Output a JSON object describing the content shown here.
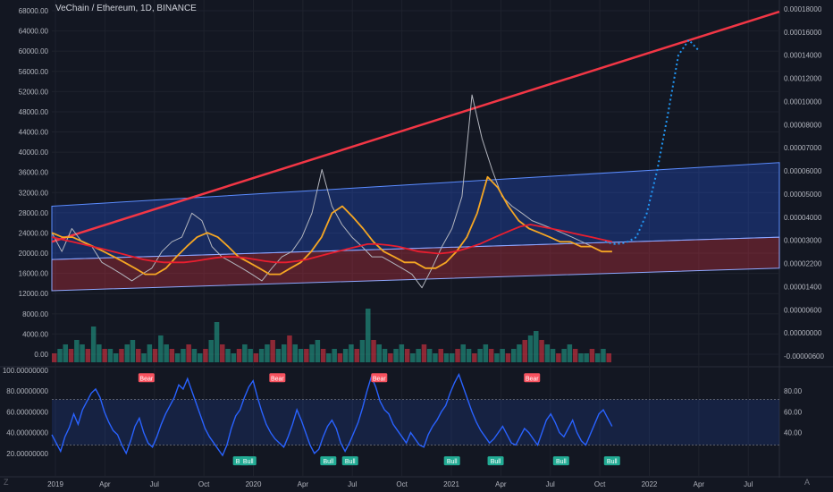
{
  "chart_title": "VeChain / Ethereum, 1D, BINANCE",
  "auto_label": "A",
  "colors": {
    "background": "#131722",
    "grid": "#1e222d",
    "price_line": "#b2b5be",
    "trend_line": "#f23645",
    "channel_blue": "#2962ff",
    "channel_red": "#f23645",
    "ma_yellow": "#f5a623",
    "ma_red": "#e91e2f",
    "projection": "#2196f3",
    "rsi_line": "#2962ff",
    "bear_label": "#f7525f",
    "bull_label": "#22ab94"
  },
  "chart_data": [
    {
      "type": "line",
      "panel": "price",
      "scale": "log",
      "x_ticks": [
        "2019",
        "Apr",
        "Jul",
        "Oct",
        "2020",
        "Apr",
        "Jul",
        "Oct",
        "2021",
        "Apr",
        "Jul",
        "Oct",
        "2022",
        "Apr",
        "Jul"
      ],
      "x": [
        0,
        1,
        2,
        3,
        4,
        5,
        6,
        7,
        8,
        9,
        10,
        11,
        12,
        13,
        14
      ],
      "left_y_ticks": [
        "68000.00",
        "64000.00",
        "60000.00",
        "56000.00",
        "52000.00",
        "48000.00",
        "44000.00",
        "40000.00",
        "36000.00",
        "32000.00",
        "28000.00",
        "24000.00",
        "20000.00",
        "16000.00",
        "12000.00",
        "8000.00",
        "4000.00",
        "0.00"
      ],
      "right_y_ticks": [
        "0.00018000",
        "0.00016000",
        "0.00014000",
        "0.00012000",
        "0.00010000",
        "0.00008000",
        "0.00007000",
        "0.00006000",
        "0.00005000",
        "0.00004000",
        "0.00003000",
        "0.00002200",
        "0.00001400",
        "0.00000600",
        "0.00000000",
        "-0.00000600"
      ],
      "series": [
        {
          "key": "price",
          "values": [
            25,
            21,
            26,
            23,
            22,
            19,
            18,
            17,
            16,
            17,
            18,
            21,
            23,
            24,
            30,
            28,
            22,
            20,
            19,
            18,
            17,
            16,
            18,
            20,
            21,
            24,
            30,
            45,
            32,
            27,
            24,
            22,
            20,
            20,
            19,
            18,
            17,
            15,
            18,
            22,
            26,
            35,
            90,
            60,
            45,
            35,
            32,
            30,
            28,
            27,
            26,
            25,
            24,
            23,
            22,
            21,
            21
          ]
        },
        {
          "key": "ma_yellow",
          "values": [
            25,
            24,
            24,
            23,
            22,
            21,
            20,
            19,
            18,
            17,
            17,
            18,
            20,
            22,
            24,
            25,
            24,
            22,
            20,
            19,
            18,
            17,
            17,
            18,
            19,
            21,
            24,
            30,
            32,
            29,
            26,
            23,
            21,
            20,
            19,
            19,
            18,
            18,
            19,
            21,
            24,
            30,
            42,
            38,
            32,
            28,
            26,
            25,
            24,
            23,
            23,
            22,
            22,
            21,
            21
          ]
        },
        {
          "key": "ma_red",
          "values": [
            24,
            23.5,
            23,
            22.5,
            22,
            21.5,
            21,
            20.5,
            20,
            19.5,
            19.2,
            19,
            19,
            19,
            19.2,
            19.5,
            19.8,
            20,
            20,
            19.8,
            19.5,
            19.2,
            19,
            19,
            19.2,
            19.5,
            20,
            20.5,
            21,
            21.5,
            22,
            22.5,
            22.5,
            22.3,
            22,
            21.5,
            21,
            20.8,
            20.6,
            20.8,
            21.2,
            21.8,
            22.5,
            23.5,
            24.5,
            25.5,
            26.5,
            27,
            26.5,
            26,
            25.5,
            25,
            24.5,
            24,
            23.5,
            23
          ]
        },
        {
          "key": "projection",
          "values": [
            23,
            22.5,
            22.8,
            24,
            30,
            45,
            75,
            130,
            150,
            135
          ]
        }
      ]
    },
    {
      "type": "line",
      "panel": "oscillator",
      "left_y_ticks": [
        "100.00000000",
        "80.00000000",
        "60.00000000",
        "40.00000000",
        "20.00000000"
      ],
      "right_y_ticks": [
        "80.00",
        "60.00",
        "40.00"
      ],
      "signals": [
        {
          "label": "Bear",
          "kind": "bear",
          "t": 0.13
        },
        {
          "label": "Bull",
          "kind": "bull",
          "t": 0.26
        },
        {
          "label": "Bull",
          "kind": "bull",
          "t": 0.27
        },
        {
          "label": "Bear",
          "kind": "bear",
          "t": 0.31
        },
        {
          "label": "Bull",
          "kind": "bull",
          "t": 0.38
        },
        {
          "label": "Bull",
          "kind": "bull",
          "t": 0.41
        },
        {
          "label": "Bear",
          "kind": "bear",
          "t": 0.45
        },
        {
          "label": "Bull",
          "kind": "bull",
          "t": 0.55
        },
        {
          "label": "Bull",
          "kind": "bull",
          "t": 0.61
        },
        {
          "label": "Bear",
          "kind": "bear",
          "t": 0.66
        },
        {
          "label": "Bull",
          "kind": "bull",
          "t": 0.7
        },
        {
          "label": "Bull",
          "kind": "bull",
          "t": 0.77
        }
      ],
      "values": [
        38,
        30,
        22,
        36,
        45,
        58,
        48,
        62,
        70,
        78,
        82,
        74,
        60,
        50,
        42,
        38,
        28,
        20,
        32,
        46,
        54,
        40,
        30,
        26,
        36,
        48,
        58,
        66,
        74,
        86,
        82,
        92,
        80,
        68,
        56,
        44,
        36,
        30,
        24,
        18,
        28,
        44,
        56,
        62,
        74,
        84,
        90,
        74,
        60,
        48,
        40,
        34,
        30,
        26,
        36,
        48,
        62,
        52,
        40,
        28,
        20,
        24,
        36,
        46,
        52,
        44,
        30,
        22,
        30,
        40,
        50,
        64,
        80,
        94,
        84,
        70,
        62,
        58,
        48,
        42,
        36,
        30,
        40,
        34,
        28,
        26,
        38,
        46,
        52,
        60,
        66,
        78,
        88,
        96,
        84,
        72,
        60,
        50,
        42,
        36,
        30,
        34,
        40,
        46,
        38,
        30,
        28,
        36,
        44,
        40,
        34,
        28,
        40,
        52,
        58,
        50,
        40,
        36,
        44,
        52,
        40,
        32,
        28,
        38,
        48,
        58,
        62,
        54,
        46
      ]
    },
    {
      "type": "bar",
      "panel": "volume",
      "values": [
        2,
        3,
        4,
        3,
        5,
        4,
        3,
        8,
        4,
        3,
        3,
        2,
        3,
        4,
        5,
        3,
        2,
        4,
        3,
        6,
        4,
        3,
        2,
        3,
        4,
        3,
        2,
        3,
        5,
        9,
        4,
        3,
        2,
        3,
        4,
        3,
        2,
        3,
        4,
        5,
        3,
        4,
        6,
        4,
        3,
        3,
        4,
        5,
        3,
        2,
        3,
        2,
        3,
        4,
        3,
        5,
        12,
        5,
        4,
        3,
        2,
        3,
        4,
        3,
        2,
        3,
        4,
        3,
        2,
        3,
        2,
        2,
        3,
        4,
        3,
        2,
        3,
        4,
        3,
        2,
        3,
        2,
        3,
        4,
        5,
        6,
        7,
        5,
        4,
        3,
        2,
        3,
        4,
        3,
        2,
        2,
        3,
        2,
        3,
        2
      ]
    }
  ]
}
